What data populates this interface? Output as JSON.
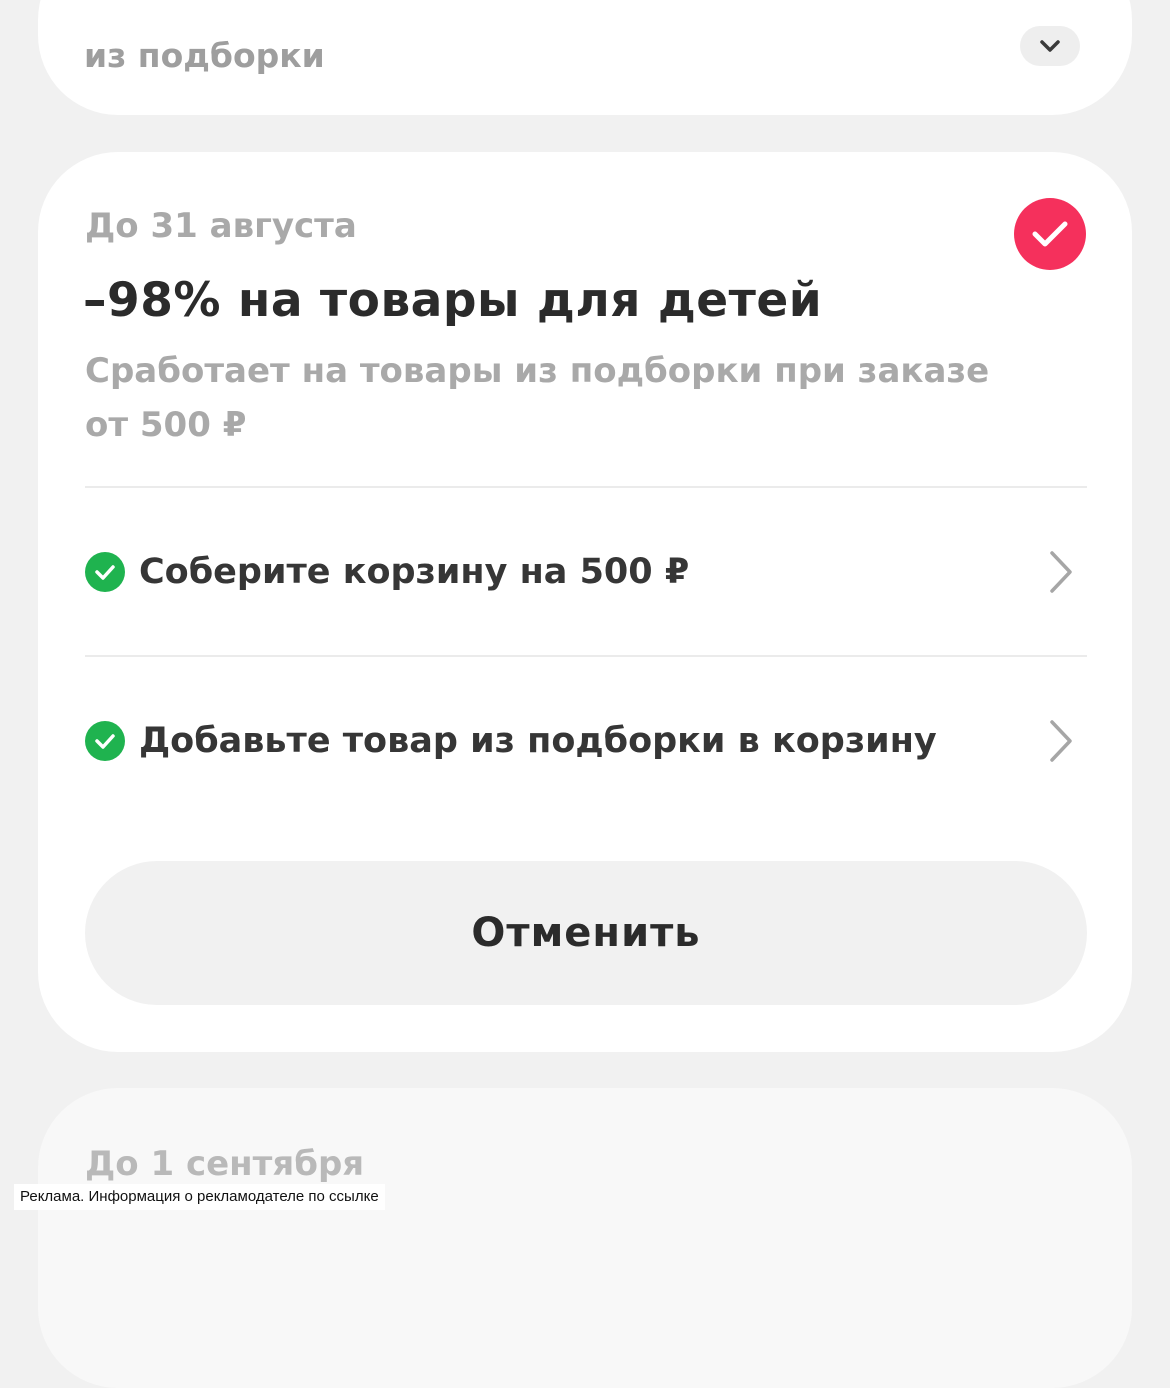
{
  "top_card": {
    "description_line2": "из подборки",
    "expand_icon": "chevron-down-icon"
  },
  "main_card": {
    "deadline": "До 31 августа",
    "title": "–98% на товары для детей",
    "description": "Сработает на товары из подборки при заказе от 500 ₽",
    "selected_icon": "checkmark-icon",
    "selected_color": "#f5305c",
    "conditions": [
      {
        "label": "Соберите корзину на 500 ₽",
        "status_icon": "check-circle-icon",
        "action_icon": "chevron-right-icon"
      },
      {
        "label": "Добавьте товар из подборки в корзину",
        "status_icon": "check-circle-icon",
        "action_icon": "chevron-right-icon"
      }
    ],
    "condition_done_color": "#1fb34f",
    "cancel_label": "Отменить"
  },
  "bottom_card": {
    "deadline": "До 1 сентября"
  },
  "ad_disclaimer": "Реклама. Информация о рекламодателе по ссылке"
}
